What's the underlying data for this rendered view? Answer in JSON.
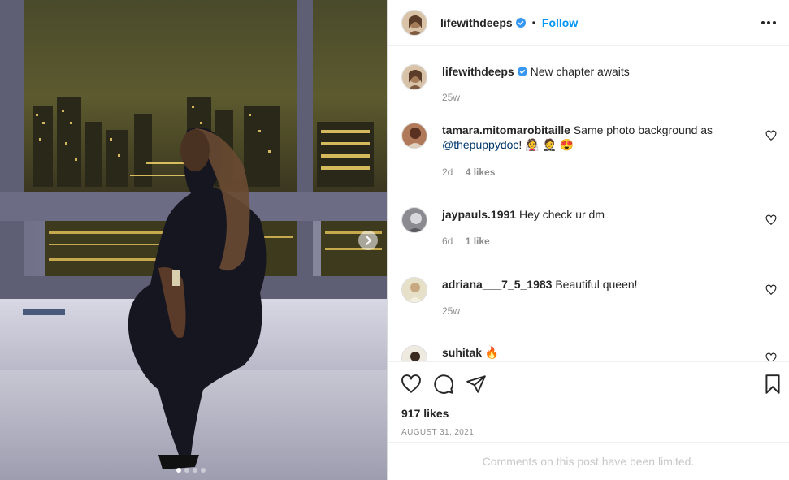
{
  "post": {
    "username": "lifewithdeeps",
    "follow_label": "Follow",
    "separator": "•",
    "caption": "New chapter awaits",
    "caption_time": "25w",
    "carousel": {
      "slide_count": 4,
      "active_index": 0
    }
  },
  "comments": [
    {
      "username": "tamara.mitomarobitaille",
      "text": "Same photo background as",
      "mention": "@thepuppydoc",
      "text_after": "! 👰 🤵 😍",
      "time": "2d",
      "likes": "4 likes"
    },
    {
      "username": "jaypauls.1991",
      "text": "Hey check ur dm",
      "time": "6d",
      "likes": "1 like"
    },
    {
      "username": "adriana___7_5_1983",
      "text": "Beautiful queen!",
      "time": "25w",
      "likes": ""
    },
    {
      "username": "suhitak",
      "text": "🔥",
      "time": "",
      "likes": ""
    }
  ],
  "actions": {
    "likes_count": "917 likes",
    "date": "AUGUST 31, 2021"
  },
  "footer": {
    "limited_text": "Comments on this post have been limited."
  },
  "colors": {
    "accent": "#0095f6",
    "verified": "#3897f0",
    "mention": "#00376b"
  }
}
